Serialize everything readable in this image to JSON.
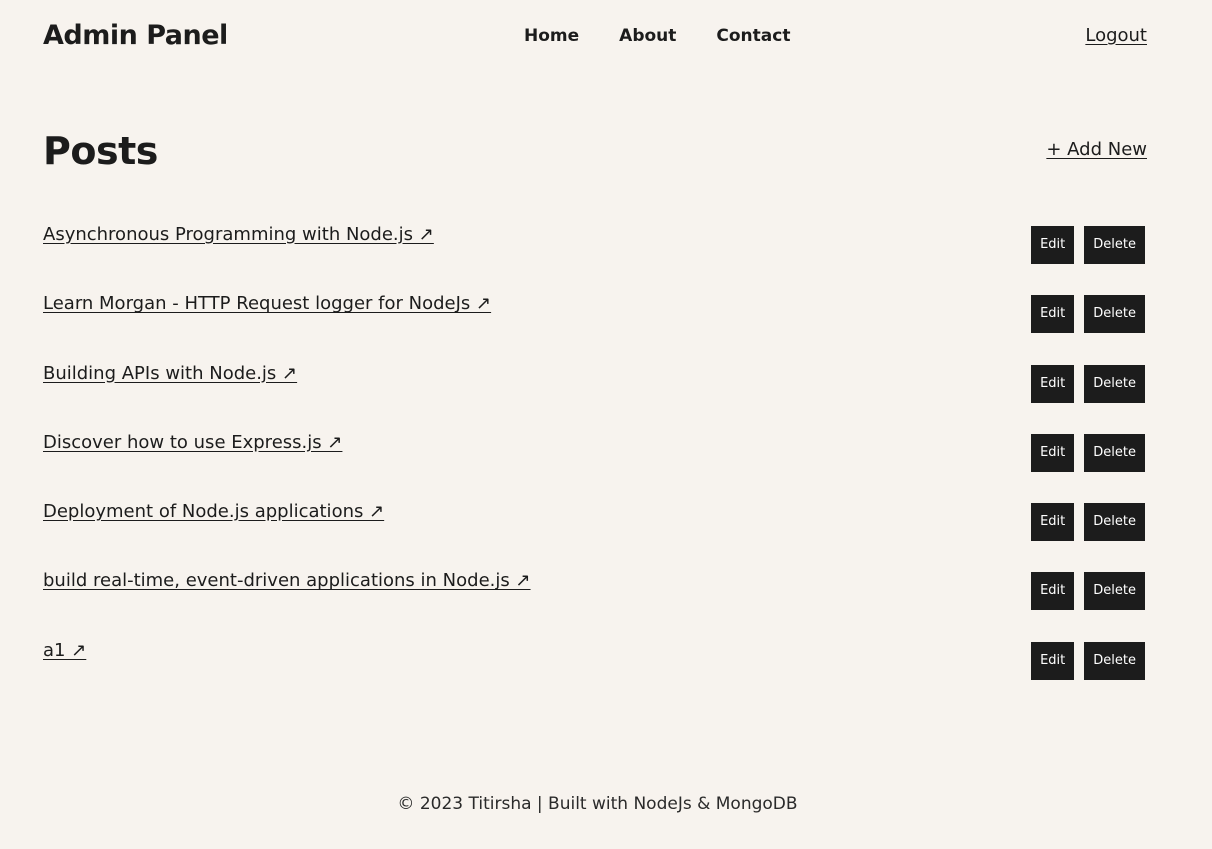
{
  "header": {
    "logo": "Admin Panel",
    "nav": [
      "Home",
      "About",
      "Contact"
    ],
    "logout": "Logout"
  },
  "admin": {
    "title": "Posts",
    "add_new": "+ Add New"
  },
  "posts": [
    {
      "title": "Asynchronous Programming with Node.js ↗",
      "edit": "Edit",
      "delete": "Delete"
    },
    {
      "title": "Learn Morgan - HTTP Request logger for NodeJs ↗",
      "edit": "Edit",
      "delete": "Delete"
    },
    {
      "title": "Building APIs with Node.js ↗",
      "edit": "Edit",
      "delete": "Delete"
    },
    {
      "title": "Discover how to use Express.js ↗",
      "edit": "Edit",
      "delete": "Delete"
    },
    {
      "title": "Deployment of Node.js applications ↗",
      "edit": "Edit",
      "delete": "Delete"
    },
    {
      "title": "build real-time, event-driven applications in Node.js ↗",
      "edit": "Edit",
      "delete": "Delete"
    },
    {
      "title": "a1 ↗",
      "edit": "Edit",
      "delete": "Delete"
    }
  ],
  "footer": {
    "text": "© 2023 Titirsha | Built with NodeJs & MongoDB"
  },
  "colors": {
    "background": "#f7f3ee",
    "text": "#1c1c1c",
    "button_bg": "#1c1c1c",
    "button_text": "#ffffff"
  }
}
